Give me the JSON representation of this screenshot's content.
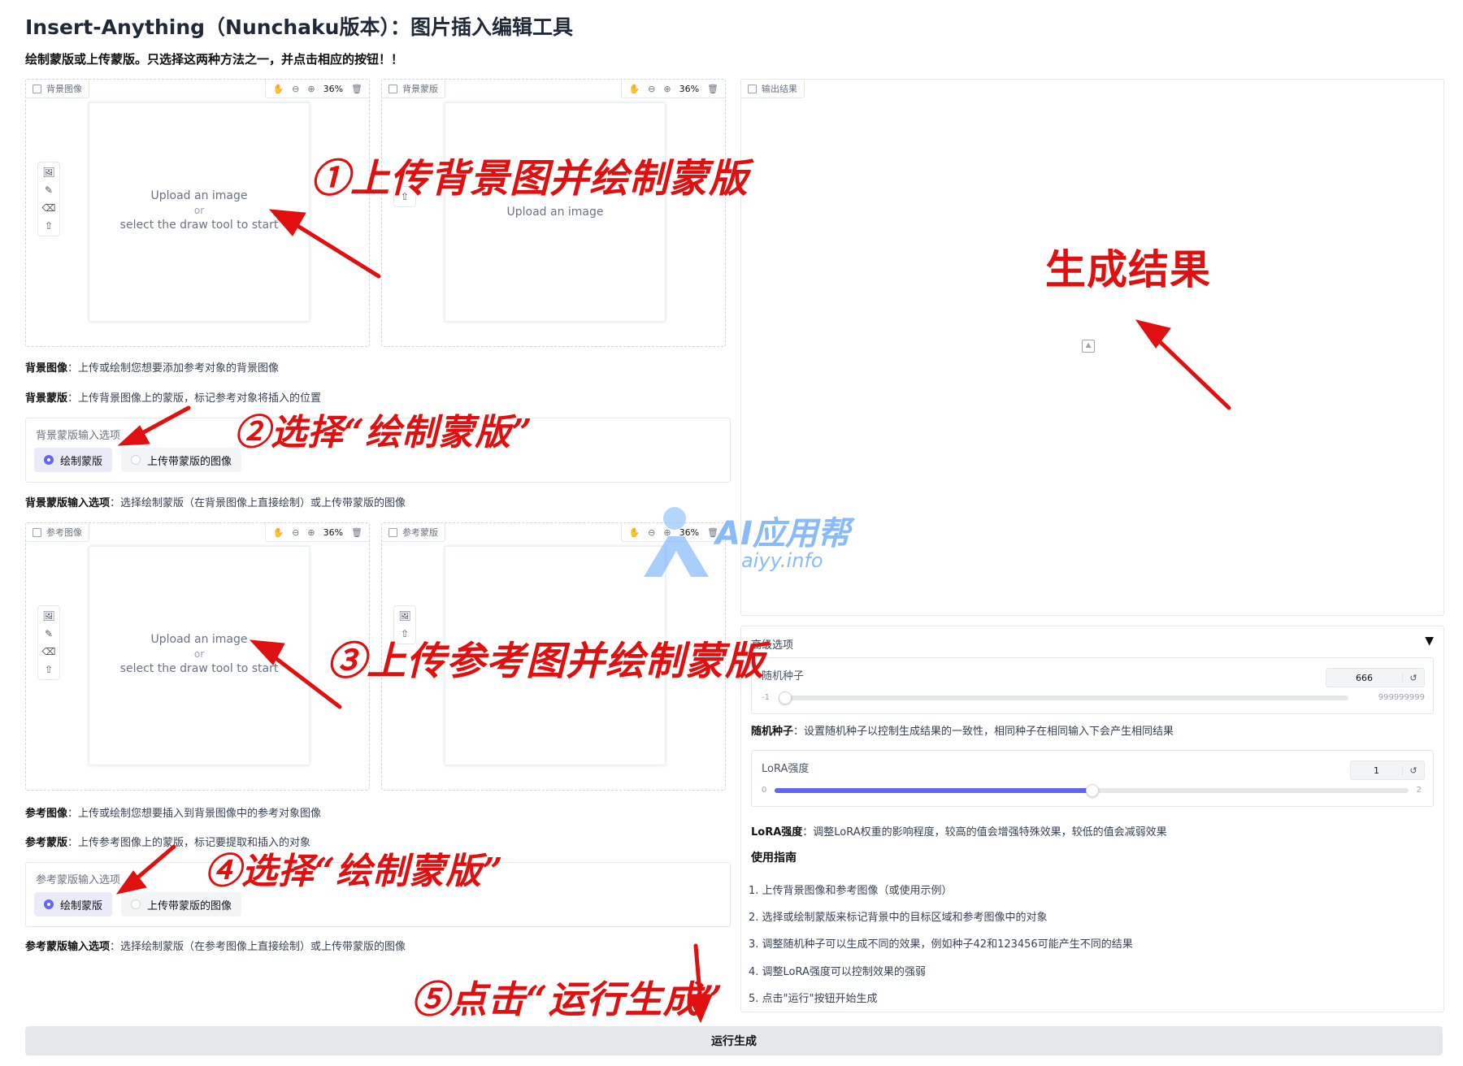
{
  "header": {
    "title": "Insert-Anything（Nunchaku版本）：图片插入编辑工具",
    "subtitle": "绘制蒙版或上传蒙版。只选择这两种方法之一，并点击相应的按钮！！"
  },
  "editors": {
    "bg_image": {
      "label": "背景图像",
      "zoom": "36%",
      "line1": "Upload an image",
      "line2": "or",
      "line3": "select the draw tool to start"
    },
    "bg_mask": {
      "label": "背景蒙版",
      "zoom": "36%",
      "line1": "Upload an image"
    },
    "ref_image": {
      "label": "参考图像",
      "zoom": "36%",
      "line1": "Upload an image",
      "line2": "or",
      "line3": "select the draw tool to start"
    },
    "ref_mask": {
      "label": "参考蒙版",
      "zoom": "36%"
    }
  },
  "output": {
    "label": "输出结果"
  },
  "descriptions": {
    "bg_image_key": "背景图像",
    "bg_image_text": "：上传或绘制您想要添加参考对象的背景图像",
    "bg_mask_key": "背景蒙版",
    "bg_mask_text": "：上传背景图像上的蒙版，标记参考对象将插入的位置",
    "bg_opt_key": "背景蒙版输入选项",
    "bg_opt_text": "：选择绘制蒙版（在背景图像上直接绘制）或上传带蒙版的图像",
    "ref_image_key": "参考图像",
    "ref_image_text": "：上传或绘制您想要插入到背景图像中的参考对象图像",
    "ref_mask_key": "参考蒙版",
    "ref_mask_text": "：上传参考图像上的蒙版，标记要提取和插入的对象",
    "ref_opt_key": "参考蒙版输入选项",
    "ref_opt_text": "：选择绘制蒙版（在参考图像上直接绘制）或上传带蒙版的图像"
  },
  "bg_mask_options": {
    "label": "背景蒙版输入选项",
    "opt1": "绘制蒙版",
    "opt2": "上传带蒙版的图像"
  },
  "ref_mask_options": {
    "label": "参考蒙版输入选项",
    "opt1": "绘制蒙版",
    "opt2": "上传带蒙版的图像"
  },
  "advanced": {
    "title": "高级选项",
    "collapse_glyph": "▼",
    "seed": {
      "label": "随机种子",
      "value": "666",
      "min": "-1",
      "max": "999999999",
      "fraction": 0.0
    },
    "seed_desc_key": "随机种子",
    "seed_desc_text": "：设置随机种子以控制生成结果的一致性，相同种子在相同输入下会产生相同结果",
    "lora": {
      "label": "LoRA强度",
      "value": "1",
      "min": "0",
      "max": "2",
      "fraction": 0.5
    },
    "lora_desc_key": "LoRA强度",
    "lora_desc_text": "：调整LoRA权重的影响程度，较高的值会增强特殊效果，较低的值会减弱效果",
    "guide_title": "使用指南",
    "guide": [
      "1. 上传背景图像和参考图像（或使用示例）",
      "2. 选择或绘制蒙版来标记背景中的目标区域和参考图像中的对象",
      "3. 调整随机种子可以生成不同的效果，例如种子42和123456可能产生不同的结果",
      "4. 调整LoRA强度可以控制效果的强弱",
      "5. 点击\"运行\"按钮开始生成"
    ]
  },
  "run_button": "运行生成",
  "annotations": {
    "a1": "①上传背景图并绘制蒙版",
    "a2": "②选择“绘制蒙版”",
    "a3": "③上传参考图并绘制蒙版",
    "a4": "④选择“绘制蒙版”",
    "a5": "⑤点击“运行生成”",
    "result": "生成结果"
  },
  "watermark": {
    "brand": "AI应用帮",
    "url": "aiyy.info"
  },
  "colors": {
    "accent": "#6366f1",
    "annotation_red": "#e01010",
    "watermark_blue": "#60a5fa"
  }
}
